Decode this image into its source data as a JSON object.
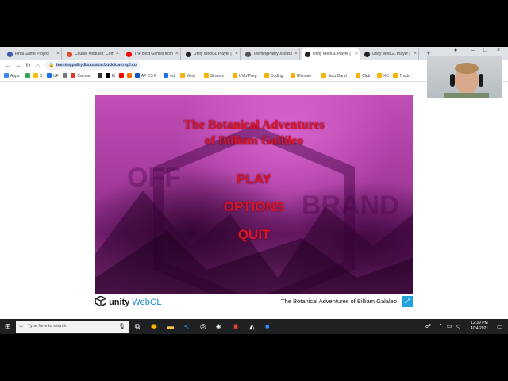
{
  "browser": {
    "tabs": [
      {
        "label": "Final Game Project",
        "fav": "#3b5ba5"
      },
      {
        "label": "Course Modules: Com",
        "fav": "#e34c26"
      },
      {
        "label": "The Best Games from",
        "fav": "#ff0000"
      },
      {
        "label": "Unity WebGL Player |",
        "fav": "#222222"
      },
      {
        "label": "TeemingPaltryDiscuss",
        "fav": "#555555"
      },
      {
        "label": "Unity WebGL Player |",
        "fav": "#222222"
      },
      {
        "label": "Unity WebGL Player |",
        "fav": "#222222"
      }
    ],
    "new_tab": "+",
    "url": "teemingpaltrydiscussion.bucklidav.repl.co",
    "bookmarks": [
      {
        "label": "Apps",
        "color": "#4285f4"
      },
      {
        "label": "",
        "color": "#34a853"
      },
      {
        "label": "C",
        "color": "#fbbc05"
      },
      {
        "label": "UF",
        "color": "#1a73e8"
      },
      {
        "label": "",
        "color": "#777777"
      },
      {
        "label": "Canvas",
        "color": "#e13b2b"
      },
      {
        "label": "",
        "color": "#333333"
      },
      {
        "label": "M",
        "color": "#000000"
      },
      {
        "label": "",
        "color": "#ff0000"
      },
      {
        "label": "",
        "color": "#ff6d00"
      },
      {
        "label": "AP CS P",
        "color": "#1155cc"
      },
      {
        "label": "ed",
        "color": "#1a73e8"
      },
      {
        "label": "Merit",
        "color": "#f4b400"
      },
      {
        "label": "Strands",
        "color": "#f4b400"
      },
      {
        "label": "UVU Prep",
        "color": "#f4b400"
      },
      {
        "label": "Coding",
        "color": "#f4b400"
      },
      {
        "label": "Ultimate",
        "color": "#f4b400"
      },
      {
        "label": "Jazz Band",
        "color": "#f4b400"
      },
      {
        "label": "Club",
        "color": "#f4b400"
      },
      {
        "label": "XC",
        "color": "#f4b400"
      },
      {
        "label": "Track",
        "color": "#f4b400"
      }
    ]
  },
  "game": {
    "title_line1": "The Botanical Adventures",
    "title_line2": "of Billiam Gallileo",
    "play_label": "PLAY",
    "options_label": "OPTIONS",
    "quit_label": "QUIT",
    "text_color": "#d8152a"
  },
  "footer": {
    "unity_label": "unity",
    "webgl_label": "WebGL",
    "game_name": "The Botanical Adventures of Billiam Galaleo"
  },
  "taskbar": {
    "search_placeholder": "Type here to search",
    "time": "12:39 PM",
    "date": "4/24/2021"
  }
}
